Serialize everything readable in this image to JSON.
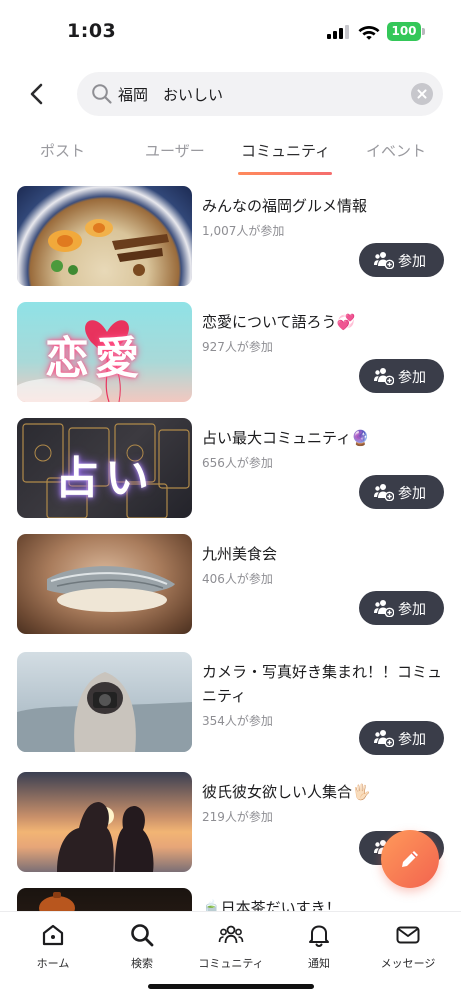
{
  "status_bar": {
    "time": "1:03",
    "battery": "100"
  },
  "search": {
    "query": "福岡　おいしい"
  },
  "tabs": [
    {
      "label": "ポスト",
      "active": false
    },
    {
      "label": "ユーザー",
      "active": false
    },
    {
      "label": "コミュニティ",
      "active": true
    },
    {
      "label": "イベント",
      "active": false
    }
  ],
  "communities": [
    {
      "title": "みんなの福岡グルメ情報",
      "members": "1,007人が参加",
      "join_label": "参加",
      "thumb_text": ""
    },
    {
      "title": "恋愛について語ろう💞",
      "members": "927人が参加",
      "join_label": "参加",
      "thumb_text": "恋愛"
    },
    {
      "title": "占い最大コミュニティ🔮",
      "members": "656人が参加",
      "join_label": "参加",
      "thumb_text": "占い"
    },
    {
      "title": "九州美食会",
      "members": "406人が参加",
      "join_label": "参加",
      "thumb_text": ""
    },
    {
      "title": "カメラ・写真好き集まれ！！コミュニティ",
      "members": "354人が参加",
      "join_label": "参加",
      "thumb_text": ""
    },
    {
      "title": "彼氏彼女欲しい人集合🖐🏻",
      "members": "219人が参加",
      "join_label": "参加",
      "thumb_text": ""
    },
    {
      "title": "🍵日本茶だいすき！",
      "members": "",
      "join_label": "",
      "thumb_text": ""
    }
  ],
  "bottom_nav": [
    {
      "label": "ホーム",
      "icon": "home-icon"
    },
    {
      "label": "検索",
      "icon": "search-icon"
    },
    {
      "label": "コミュニティ",
      "icon": "community-icon"
    },
    {
      "label": "通知",
      "icon": "bell-icon"
    },
    {
      "label": "メッセージ",
      "icon": "mail-icon"
    }
  ],
  "colors": {
    "accent_gradient_start": "#ff9a5a",
    "accent_gradient_end": "#f2634f",
    "join_button": "#3a3d49",
    "battery": "#34c759"
  }
}
